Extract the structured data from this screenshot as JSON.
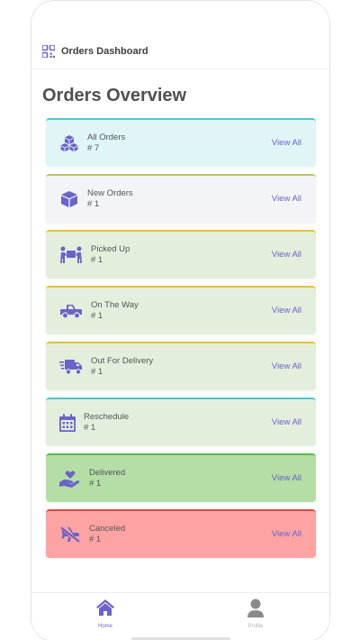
{
  "header": {
    "title": "Orders Dashboard",
    "icon": "qr-grid-icon"
  },
  "page": {
    "title": "Orders Overview"
  },
  "colors": {
    "accent": "#6b63c9"
  },
  "cards": [
    {
      "key": "all",
      "label": "All Orders",
      "count": "# 7",
      "action": "View All",
      "icon": "boxes-icon",
      "bg": "#dff5f6",
      "border": "#4fc6cf"
    },
    {
      "key": "new",
      "label": "New Orders",
      "count": "# 1",
      "action": "View All",
      "icon": "box-icon",
      "bg": "#f3f4f7",
      "border": "#b9c26a"
    },
    {
      "key": "picked",
      "label": "Picked Up",
      "count": "# 1",
      "action": "View All",
      "icon": "people-carry-icon",
      "bg": "#e3efdc",
      "border": "#e0c23a"
    },
    {
      "key": "ontheway",
      "label": "On The Way",
      "count": "# 1",
      "action": "View All",
      "icon": "truck-pickup-icon",
      "bg": "#e3efdc",
      "border": "#e0c23a"
    },
    {
      "key": "outfordelivery",
      "label": "Out For Delivery",
      "count": "# 1",
      "action": "View All",
      "icon": "shipping-fast-icon",
      "bg": "#e3efdc",
      "border": "#e0c23a"
    },
    {
      "key": "reschedule",
      "label": "Reschedule",
      "count": "# 1",
      "action": "View All",
      "icon": "calendar-icon",
      "bg": "#e3efdc",
      "border": "#4fc6cf"
    },
    {
      "key": "delivered",
      "label": "Delivered",
      "count": "# 1",
      "action": "View All",
      "icon": "hand-holding-heart-icon",
      "bg": "#b4dea5",
      "border": "#56b84a"
    },
    {
      "key": "canceled",
      "label": "Canceled",
      "count": "# 1",
      "action": "View All",
      "icon": "plane-slash-icon",
      "bg": "#fda3a3",
      "border": "#e04848"
    }
  ],
  "tabs": {
    "home": "Home",
    "profile": "Profile"
  }
}
